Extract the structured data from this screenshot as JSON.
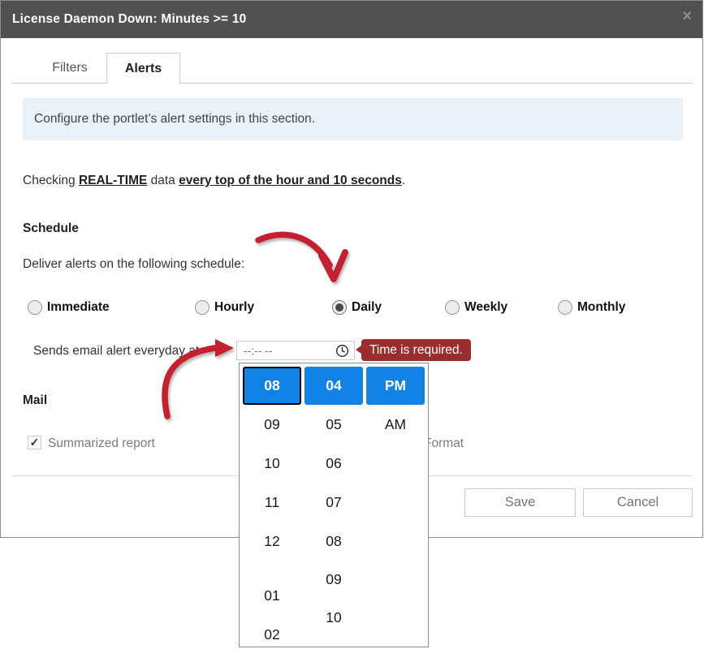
{
  "modal": {
    "title": "License Daemon Down: Minutes >= 10",
    "close_icon": "×"
  },
  "tabs": {
    "filters": "Filters",
    "alerts": "Alerts"
  },
  "info_banner": "Configure the portlet’s alert settings in this section.",
  "checking": {
    "prefix": "Checking ",
    "realtime": "REAL-TIME",
    "middle": " data ",
    "frequency": "every top of the hour and 10 seconds",
    "suffix": "."
  },
  "schedule": {
    "heading": "Schedule",
    "subtitle": "Deliver alerts on the following schedule:",
    "options": [
      {
        "label": "Immediate",
        "selected": false
      },
      {
        "label": "Hourly",
        "selected": false
      },
      {
        "label": "Daily",
        "selected": true
      },
      {
        "label": "Weekly",
        "selected": false
      },
      {
        "label": "Monthly",
        "selected": false
      }
    ]
  },
  "time_field": {
    "label": "Sends email alert everyday at",
    "placeholder": "--:-- --",
    "error": "Time is required."
  },
  "time_picker": {
    "hours": {
      "selected": "08",
      "items": [
        "09",
        "10",
        "11",
        "12",
        "01",
        "02"
      ]
    },
    "minutes": {
      "selected": "04",
      "items": [
        "05",
        "06",
        "07",
        "08",
        "09",
        "10"
      ]
    },
    "meridiem": {
      "selected": "PM",
      "items": [
        "AM"
      ]
    }
  },
  "mail": {
    "heading": "Mail",
    "summarized_label": "Summarized report",
    "summarized_checked": true,
    "checkmark": "✓",
    "format_label_partial": "Format"
  },
  "footer": {
    "save": "Save",
    "cancel": "Cancel"
  },
  "colors": {
    "accent_blue": "#1283e6",
    "error_red": "#9c2d2d",
    "arrow_red": "#c51f30",
    "header_gray": "#515151"
  }
}
